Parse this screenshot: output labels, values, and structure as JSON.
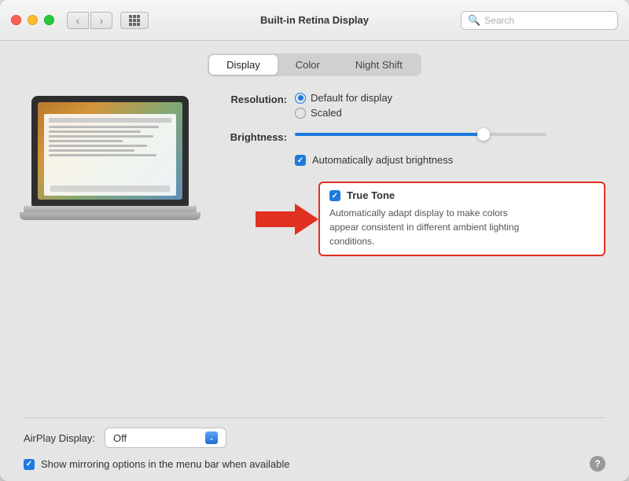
{
  "window": {
    "title": "Built-in Retina Display"
  },
  "titlebar": {
    "back_label": "‹",
    "forward_label": "›",
    "search_placeholder": "Search"
  },
  "tabs": [
    {
      "id": "display",
      "label": "Display",
      "active": true
    },
    {
      "id": "color",
      "label": "Color",
      "active": false
    },
    {
      "id": "night_shift",
      "label": "Night Shift",
      "active": false
    }
  ],
  "resolution": {
    "label": "Resolution:",
    "options": [
      {
        "id": "default",
        "label": "Default for display",
        "selected": true
      },
      {
        "id": "scaled",
        "label": "Scaled",
        "selected": false
      }
    ]
  },
  "brightness": {
    "label": "Brightness:",
    "value": 75
  },
  "auto_brightness": {
    "label": "Automatically adjust brightness",
    "checked": true
  },
  "true_tone": {
    "label": "True Tone",
    "checked": true,
    "description": "Automatically adapt display to make colors appear consistent in different ambient lighting conditions."
  },
  "airplay": {
    "label": "AirPlay Display:",
    "value": "Off"
  },
  "mirroring": {
    "label": "Show mirroring options in the menu bar when available",
    "checked": true
  },
  "help": {
    "label": "?"
  }
}
